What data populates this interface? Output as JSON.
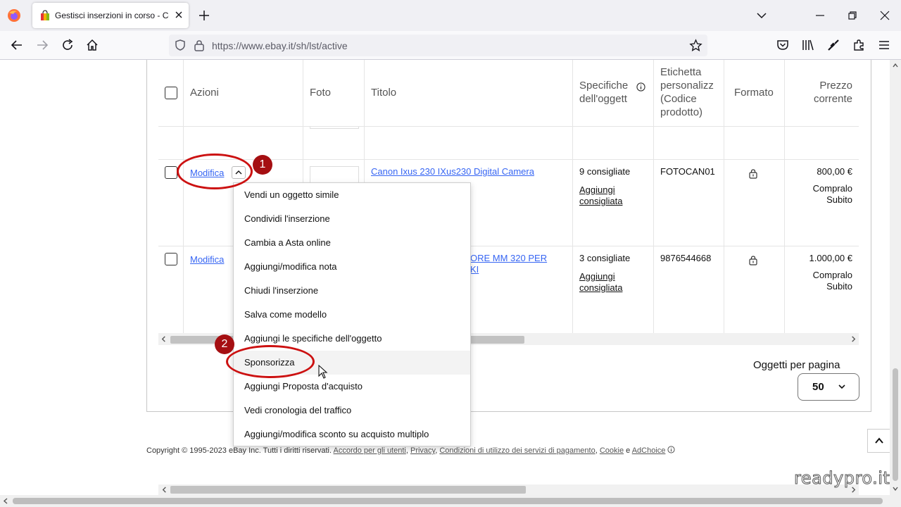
{
  "browser": {
    "tab_title": "Gestisci inserzioni in corso - Co",
    "url": "https://www.ebay.it/sh/lst/active"
  },
  "table": {
    "headers": {
      "azioni": "Azioni",
      "foto": "Foto",
      "titolo": "Titolo",
      "specifiche": [
        "Specifiche",
        "dell'oggett"
      ],
      "etichetta": [
        "Etichetta",
        "personalizz",
        "(Codice",
        "prodotto)"
      ],
      "formato": "Formato",
      "prezzo": [
        "Prezzo",
        "corrente"
      ]
    },
    "rows": [
      {
        "action": "Modifica",
        "title": "Canon Ixus 230 IXus230 Digital Camera",
        "specs_count": "9 consigliate",
        "specs_link": [
          "Aggiungi",
          "consigliata"
        ],
        "sku": "FOTOCAN01",
        "price": "800,00 €",
        "format_sub": [
          "Compralo",
          "Subito"
        ]
      },
      {
        "action": "Modifica",
        "title": [
          "ORE MM 320 PER",
          "KI"
        ],
        "specs_count": "3 consigliate",
        "specs_link": [
          "Aggiungi",
          "consigliata"
        ],
        "sku": "9876544668",
        "price": "1.000,00 €",
        "format_sub": [
          "Compralo",
          "Subito"
        ]
      }
    ]
  },
  "menu": {
    "items": [
      "Vendi un oggetto simile",
      "Condividi l'inserzione",
      "Cambia a Asta online",
      "Aggiungi/modifica nota",
      "Chiudi l'inserzione",
      "Salva come modello",
      "Aggiungi le specifiche dell'oggetto",
      "Sponsorizza",
      "Aggiungi Proposta d'acquisto",
      "Vedi cronologia del traffico",
      "Aggiungi/modifica sconto su acquisto multiplo"
    ],
    "highlighted": "Sponsorizza"
  },
  "pagination": {
    "label": "Oggetti per pagina",
    "value": "50"
  },
  "footer": {
    "copyright": "Copyright © 1995-2023 eBay Inc. Tutti i diritti riservati.",
    "links": [
      "Accordo per gli utenti",
      "Privacy",
      "Condizioni di utilizzo dei servizi di pagamento",
      "Cookie",
      "AdChoice"
    ],
    "sep_and": "e"
  },
  "annotations": {
    "badge1": "1",
    "badge2": "2",
    "accent": "#cc1111"
  },
  "watermark": "readypro.it"
}
